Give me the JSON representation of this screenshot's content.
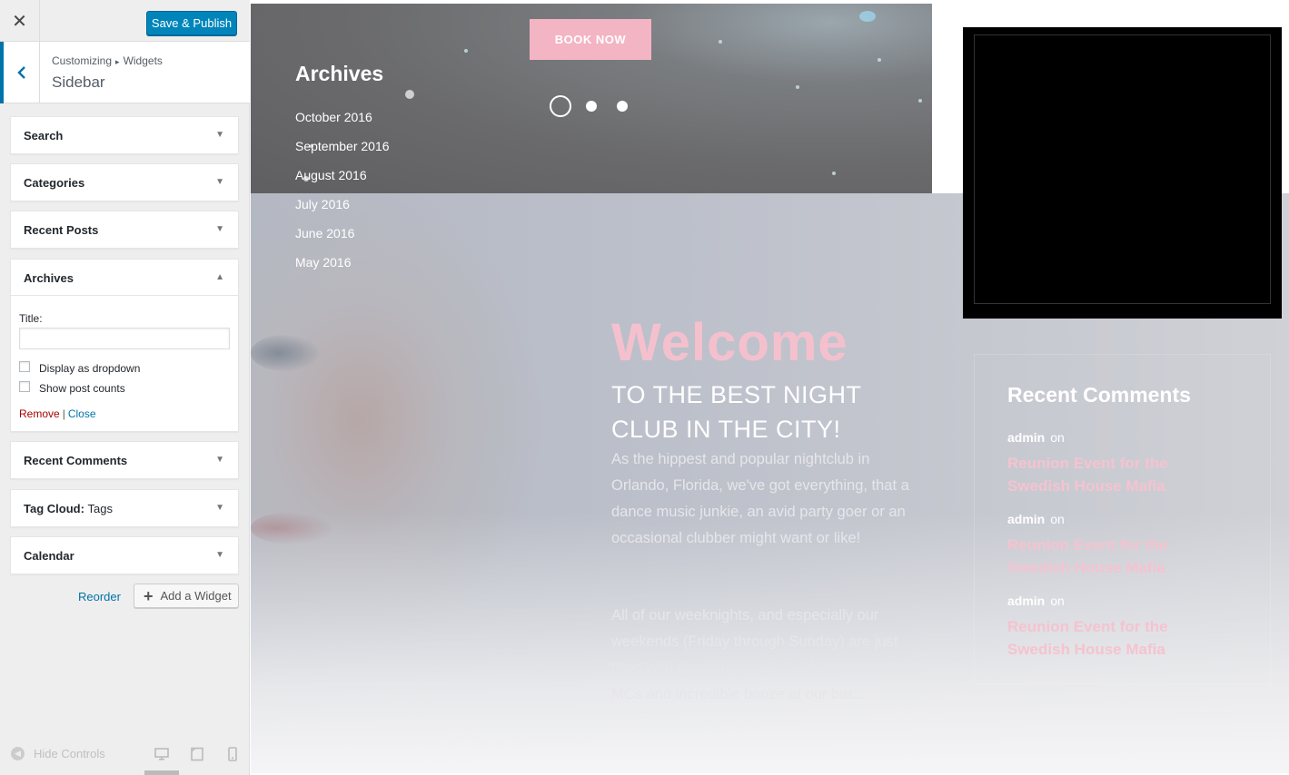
{
  "customizer": {
    "close_icon": "close-icon",
    "save_publish": "Save & Publish",
    "breadcrumb": {
      "root": "Customizing",
      "separator": "▸",
      "section": "Widgets"
    },
    "panel_title": "Sidebar",
    "widgets": [
      {
        "name": "Search",
        "suffix": "",
        "expanded": false
      },
      {
        "name": "Categories",
        "suffix": "",
        "expanded": false
      },
      {
        "name": "Recent Posts",
        "suffix": "",
        "expanded": false
      },
      {
        "name": "Archives",
        "suffix": "",
        "expanded": true
      },
      {
        "name": "Recent Comments",
        "suffix": "",
        "expanded": false
      },
      {
        "name": "Tag Cloud:",
        "suffix": "Tags",
        "expanded": false
      },
      {
        "name": "Calendar",
        "suffix": "",
        "expanded": false
      }
    ],
    "archives_form": {
      "title_label": "Title:",
      "title_value": "",
      "dropdown_label": "Display as dropdown",
      "dropdown_checked": false,
      "counts_label": "Show post counts",
      "counts_checked": false,
      "remove": "Remove",
      "separator": "|",
      "close": "Close"
    },
    "reorder": "Reorder",
    "add_widget": "Add a Widget",
    "hide_controls": "Hide Controls",
    "accent_color": "#0073aa",
    "save_button_color": "#0085ba"
  },
  "preview": {
    "book_now": "BOOK NOW",
    "slider_dots": 3,
    "active_slide": 1,
    "welcome": "Welcome",
    "subhead": "TO THE BEST NIGHT CLUB IN THE CITY!",
    "paragraph_1": "As the hippest and popular nightclub in Orlando, Florida, we've got everything, that a dance music junkie, an avid party goer or an occasional clubber might want or like!",
    "paragraph_2": "All of our weeknights, and especially our weekends (Friday through Sunday) are just filled with electrifying sets, badass DJs and MCs and incredible booze at our bar...",
    "archives": {
      "heading": "Archives",
      "months": [
        "October 2016",
        "September 2016",
        "August 2016",
        "July 2016",
        "June 2016",
        "May 2016"
      ]
    },
    "recent_comments": {
      "heading": "Recent Comments",
      "items": [
        {
          "author": "admin",
          "on": "on",
          "post": "Reunion Event for the Swedish House Mafia"
        },
        {
          "author": "admin",
          "on": "on",
          "post": "Reunion Event for the Swedish House Mafia"
        },
        {
          "author": "admin",
          "on": "on",
          "post": "Reunion Event for the Swedish House Mafia"
        }
      ]
    },
    "pink_accent": "#f5c0cd"
  }
}
